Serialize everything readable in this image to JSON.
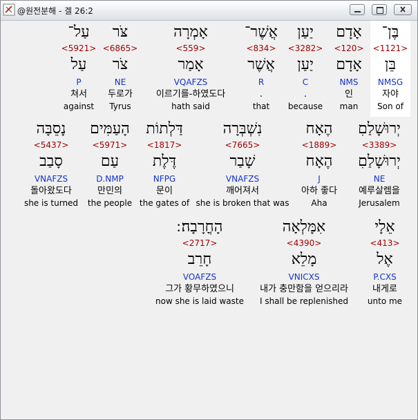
{
  "window": {
    "title": "@원전분해 - 겔 26:2"
  },
  "rows": [
    [
      {
        "heb": "בֶּן־",
        "strong": "<1121>",
        "root": "בֵּן",
        "code": "NMSG",
        "kor": "자야",
        "eng": "Son of"
      },
      {
        "heb": "אָדָם",
        "strong": "<120>",
        "root": "אָדָם",
        "code": "NMS",
        "kor": "인",
        "eng": "man"
      },
      {
        "heb": "יַעַן",
        "strong": "<3282>",
        "root": "יַעַן",
        "code": "C",
        "kor": ".",
        "eng": "because"
      },
      {
        "heb": "אֲשֶׁר־",
        "strong": "<834>",
        "root": "אֲשֶׁר",
        "code": "R",
        "kor": ".",
        "eng": "that"
      },
      {
        "heb": "אָמְרָה",
        "strong": "<559>",
        "root": "אָמַר",
        "code": "VQAFZS",
        "kor": "이르기를-하였도다",
        "eng": "hath said"
      },
      {
        "heb": "צֹּר",
        "strong": "<6865>",
        "root": "צֹר",
        "code": "NE",
        "kor": "두로가",
        "eng": "Tyrus"
      },
      {
        "heb": "עַל־",
        "strong": "<5921>",
        "root": "עַל",
        "code": "P",
        "kor": "쳐서",
        "eng": "against"
      }
    ],
    [
      {
        "heb": "יְרוּשָׁלַםִ",
        "strong": "<3389>",
        "root": "יְרוּשָׁלַםִ",
        "code": "NE",
        "kor": "예루살렘을",
        "eng": "Jerusalem"
      },
      {
        "heb": "הֶאָח",
        "strong": "<1889>",
        "root": "הֶאָח",
        "code": "J",
        "kor": "아하 좋다",
        "eng": "Aha"
      },
      {
        "heb": "נִשְׁבְּרָה",
        "strong": "<7665>",
        "root": "שָׁבַר",
        "code": "VNAFZS",
        "kor": "깨어져서",
        "eng": "she is broken that was"
      },
      {
        "heb": "דַּלְתוֹת",
        "strong": "<1817>",
        "root": "דֶּלֶת",
        "code": "NFPG",
        "kor": "문이",
        "eng": "the gates of"
      },
      {
        "heb": "הָעַמִּים",
        "strong": "<5971>",
        "root": "עַם",
        "code": "D.NMP",
        "kor": "만민의",
        "eng": "the people"
      },
      {
        "heb": "נָסֵבָּה",
        "strong": "<5437>",
        "root": "סָבַב",
        "code": "VNAFZS",
        "kor": "돌아왔도다",
        "eng": "she is turned"
      }
    ],
    [
      {
        "heb": "אֵלָי",
        "strong": "<413>",
        "root": "אֶל",
        "code": "P.CXS",
        "kor": "내게로",
        "eng": "unto me"
      },
      {
        "heb": "אִמָּלְאָה",
        "strong": "<4390>",
        "root": "מָלֵא",
        "code": "VNICXS",
        "kor": "내가 충만함을 얻으리라",
        "eng": "I shall be replenished"
      },
      {
        "heb": "הָחֳרָבָה׃ ׃",
        "strong": "<2717>",
        "root": "חָרֵב",
        "code": "VOAFZS",
        "kor": "그가 황무하였으니",
        "eng": "now she is laid waste"
      }
    ]
  ]
}
